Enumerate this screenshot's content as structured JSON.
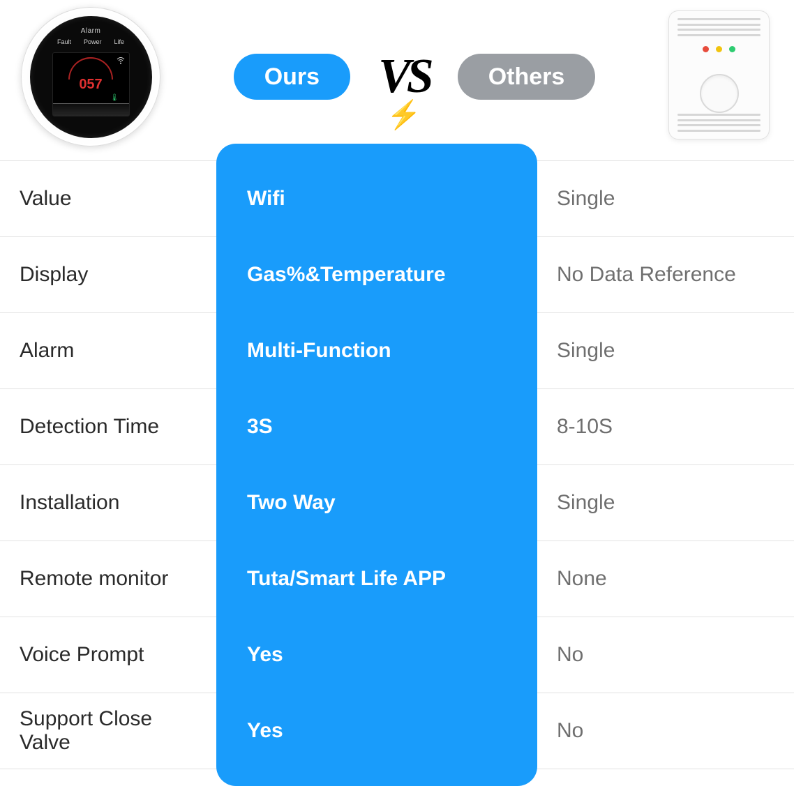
{
  "header": {
    "ours_pill": "Ours",
    "vs": "VS",
    "others_pill": "Others",
    "our_device": {
      "top_label": "Alarm",
      "row_labels": [
        "Fault",
        "Power",
        "Life"
      ],
      "reading": "057"
    }
  },
  "rows": [
    {
      "label": "Value",
      "ours": "Wifi",
      "others": "Single"
    },
    {
      "label": "Display",
      "ours": "Gas%&Temperature",
      "others": "No Data Reference"
    },
    {
      "label": "Alarm",
      "ours": "Multi-Function",
      "others": "Single"
    },
    {
      "label": "Detection Time",
      "ours": "3S",
      "others": "8-10S"
    },
    {
      "label": "Installation",
      "ours": "Two Way",
      "others": "Single"
    },
    {
      "label": "Remote monitor",
      "ours": "Tuta/Smart Life APP",
      "others": "None"
    },
    {
      "label": "Voice Prompt",
      "ours": "Yes",
      "others": "No"
    },
    {
      "label": "Support Close Valve",
      "ours": "Yes",
      "others": "No"
    }
  ],
  "colors": {
    "accent": "#199cfb",
    "grey_pill": "#9a9ea3"
  }
}
